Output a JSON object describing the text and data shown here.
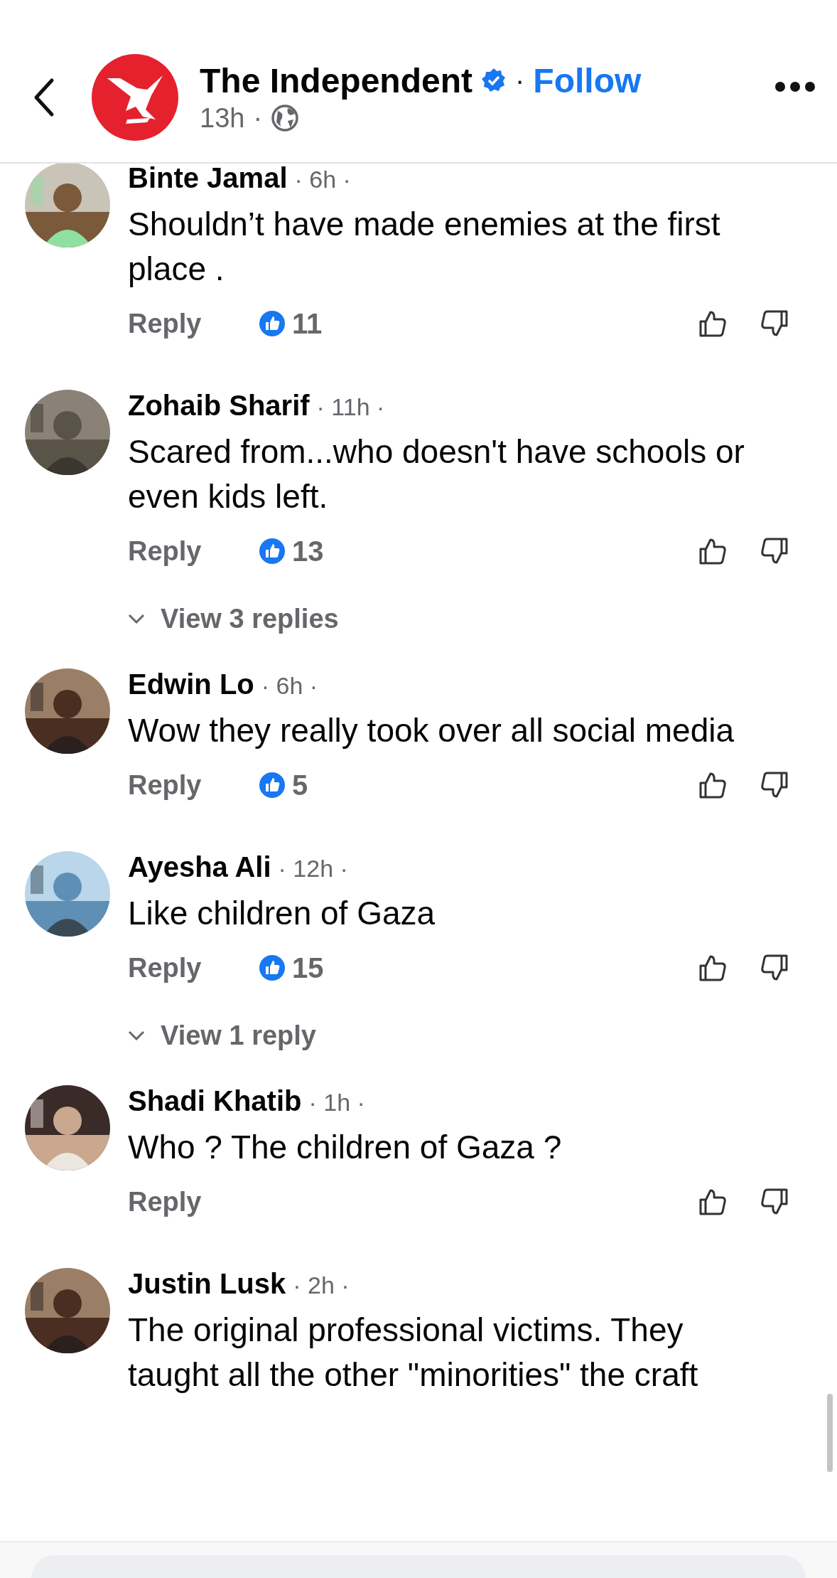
{
  "header": {
    "page_name": "The Independent",
    "separator": "·",
    "follow": "Follow",
    "time": "13h",
    "time_separator": "·"
  },
  "comments": [
    {
      "name": "Binte Jamal",
      "time": "· 6h ·",
      "text": "Shouldn’t have made enemies at the first place .",
      "reply": "Reply",
      "reactions": "11"
    },
    {
      "name": "Zohaib Sharif",
      "time": "· 11h ·",
      "text": "Scared from...who doesn't have schools or even kids left.",
      "reply": "Reply",
      "reactions": "13",
      "view_replies": "View 3 replies"
    },
    {
      "name": "Edwin Lo",
      "time": "· 6h ·",
      "text": "Wow they really took over all social media",
      "reply": "Reply",
      "reactions": "5"
    },
    {
      "name": "Ayesha Ali",
      "time": "· 12h ·",
      "text": "Like children of Gaza",
      "reply": "Reply",
      "reactions": "15",
      "view_replies": "View 1 reply"
    },
    {
      "name": "Shadi Khatib",
      "time": "· 1h ·",
      "text": "Who ? The children of Gaza ?",
      "reply": "Reply"
    },
    {
      "name": "Justin Lusk",
      "time": "· 2h ·",
      "text": "The original professional victims. They taught all the other \"minorities\" the craft"
    }
  ]
}
